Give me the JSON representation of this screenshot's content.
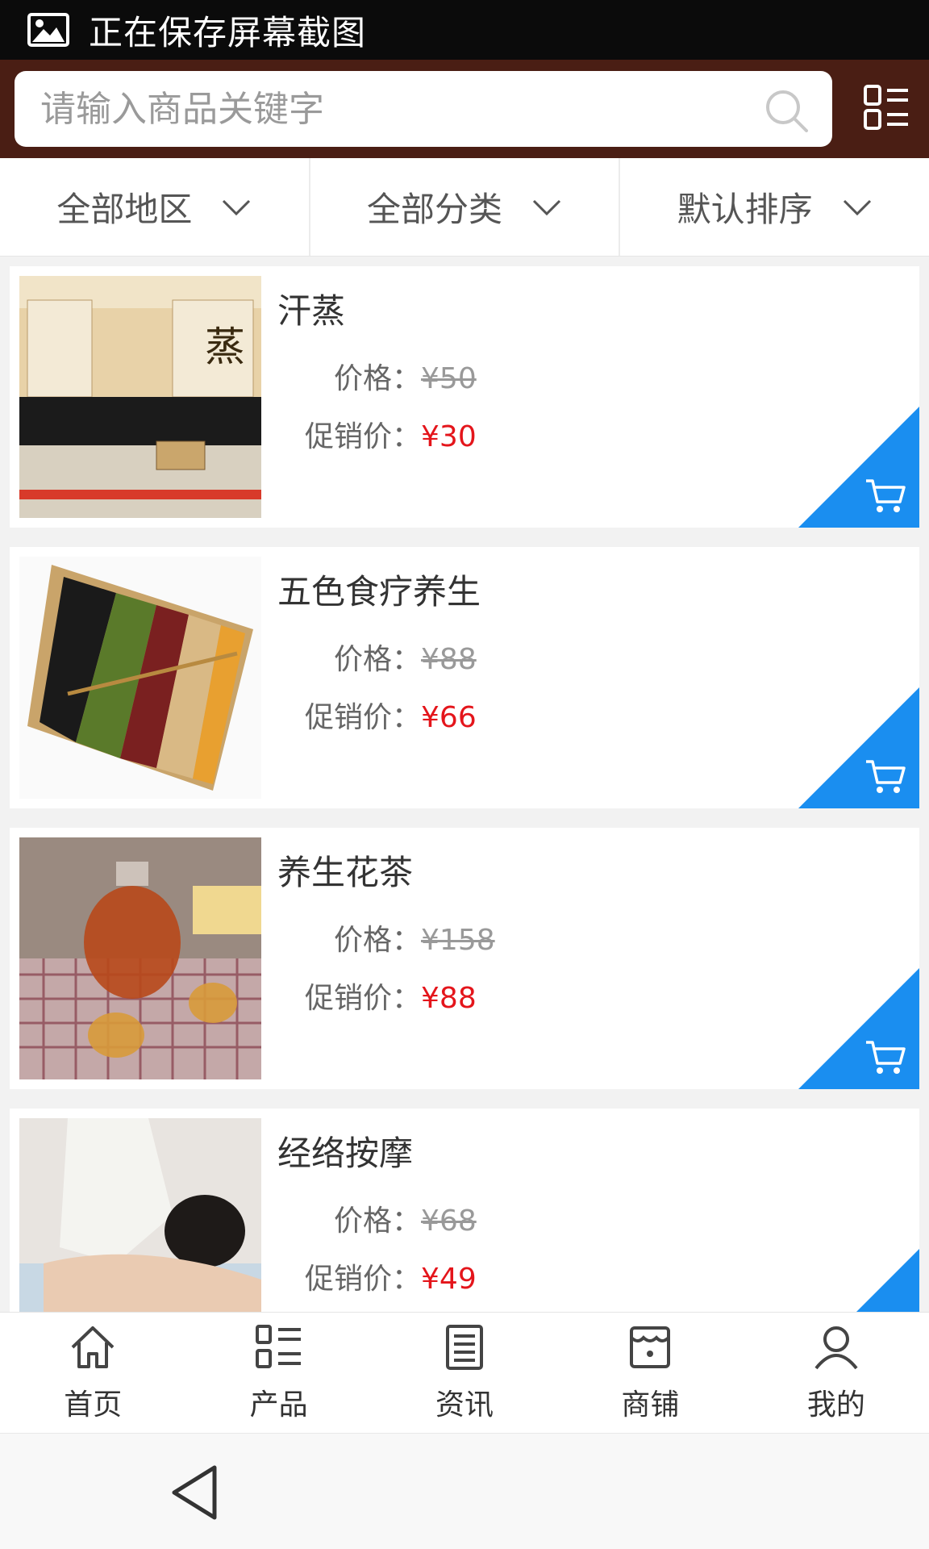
{
  "status_bar": {
    "text": "正在保存屏幕截图",
    "icon": "image-icon"
  },
  "search": {
    "placeholder": "请输入商品关键字",
    "icon": "search-icon"
  },
  "menu_icon": "grid-list-icon",
  "filters": [
    {
      "label": "全部地区"
    },
    {
      "label": "全部分类"
    },
    {
      "label": "默认排序"
    }
  ],
  "products": [
    {
      "name": "汗蒸",
      "price_label": "价格：",
      "price": "¥50",
      "promo_label": "促销价：",
      "promo_price": "¥30"
    },
    {
      "name": "五色食疗养生",
      "price_label": "价格：",
      "price": "¥88",
      "promo_label": "促销价：",
      "promo_price": "¥66"
    },
    {
      "name": "养生花茶",
      "price_label": "价格：",
      "price": "¥158",
      "promo_label": "促销价：",
      "promo_price": "¥88"
    },
    {
      "name": "经络按摩",
      "price_label": "价格：",
      "price": "¥68",
      "promo_label": "促销价：",
      "promo_price": "¥49"
    }
  ],
  "bottom_nav": [
    {
      "label": "首页",
      "icon": "home-icon"
    },
    {
      "label": "产品",
      "icon": "product-list-icon"
    },
    {
      "label": "资讯",
      "icon": "news-icon"
    },
    {
      "label": "商铺",
      "icon": "store-icon"
    },
    {
      "label": "我的",
      "icon": "user-icon"
    }
  ],
  "colors": {
    "header": "#4a1e14",
    "cart": "#1a8ef0",
    "promo": "#e4151b"
  }
}
